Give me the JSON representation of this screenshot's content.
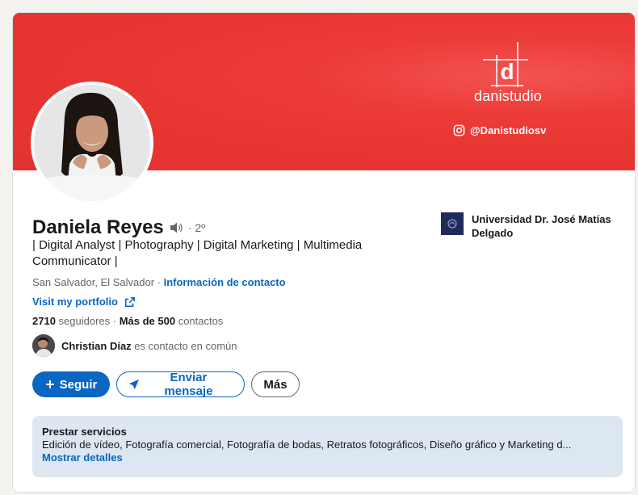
{
  "banner": {
    "brand_name": "danistudio",
    "logo_letter": "d",
    "instagram_handle": "@Danistudiosv",
    "color": "#e83532"
  },
  "profile": {
    "name": "Daniela Reyes",
    "degree": "· 2º",
    "headline": "| Digital Analyst | Photography | Digital Marketing | Multimedia Communicator |",
    "location": "San Salvador, El Salvador",
    "location_separator": " · ",
    "contact_info_label": "Información de contacto",
    "portfolio_label": "Visit my portfolio",
    "followers_count": "2710",
    "followers_label": " seguidores",
    "connections_separator": " · ",
    "connections_count": "Más de 500",
    "connections_label": " contactos",
    "mutual_name": "Christian Díaz",
    "mutual_label": " es contacto en común"
  },
  "education": {
    "school": "Universidad Dr. José Matías Delgado"
  },
  "actions": {
    "follow": "Seguir",
    "follow_icon": "plus-icon",
    "message": "Enviar mensaje",
    "message_icon": "send-icon",
    "more": "Más"
  },
  "services": {
    "title": "Prestar servicios",
    "description": "Edición de vídeo, Fotografía comercial, Fotografía de bodas, Retratos fotográficos, Diseño gráfico y Marketing d...",
    "show_details": "Mostrar detalles"
  },
  "colors": {
    "accent": "#0a66c2",
    "services_bg": "#dde7f1"
  }
}
